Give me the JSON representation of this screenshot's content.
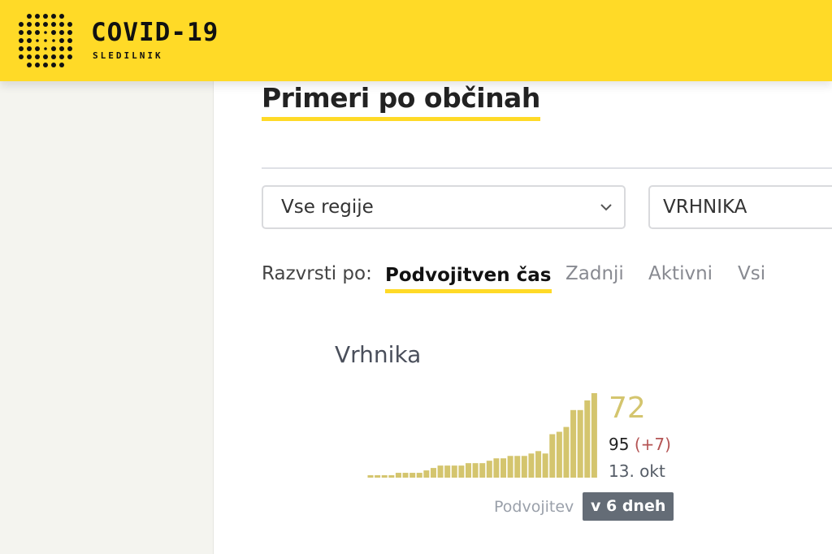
{
  "header": {
    "logo_title": "COVID-19",
    "logo_subtitle": "SLEDILNIK",
    "logo_icon": "dots-grid-logo",
    "background": "#ffda27"
  },
  "page": {
    "title": "Primeri po občinah"
  },
  "filters": {
    "region_select": {
      "value": "Vse regije",
      "icon": "chevron-down-icon"
    },
    "municipality_select": {
      "value": "VRHNIKA"
    }
  },
  "sort": {
    "label": "Razvrsti po:",
    "options": [
      {
        "label": "Podvojitven čas",
        "active": true
      },
      {
        "label": "Zadnji",
        "active": false
      },
      {
        "label": "Aktivni",
        "active": false
      },
      {
        "label": "Vsi",
        "active": false
      }
    ]
  },
  "municipality_card": {
    "name": "Vrhnika",
    "active_cases": "72",
    "total_cases": "95",
    "delta": "(+7)",
    "date": "13. okt",
    "doubling_label": "Podvojitev",
    "doubling_value": "v 6 dneh"
  },
  "chart_data": {
    "type": "bar",
    "color": "#d4c56e",
    "values": [
      1,
      1,
      1,
      1,
      2,
      2,
      2,
      2,
      3,
      4,
      5,
      5,
      5,
      5,
      6,
      6,
      6,
      7,
      8,
      8,
      9,
      9,
      9,
      10,
      11,
      10,
      18,
      19,
      21,
      28,
      28,
      32,
      35
    ]
  }
}
